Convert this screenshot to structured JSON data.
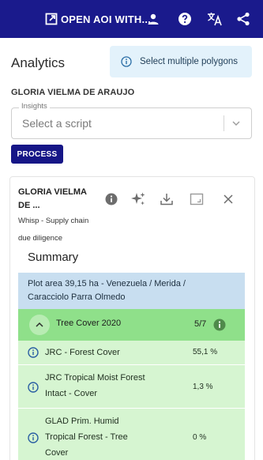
{
  "header": {
    "open_aoi_label": "OPEN AOI WITH...",
    "icons": [
      "open-in-new-icon",
      "user-icon",
      "help-icon",
      "translate-icon",
      "share-icon"
    ],
    "color": "#1a1a8c"
  },
  "panel": {
    "title": "Analytics",
    "hint": "Select multiple polygons",
    "owner": "GLORIA VIELMA DE ARAUJO"
  },
  "insights": {
    "legend": "Insights",
    "placeholder": "Select a script"
  },
  "process_label": "PROCESS",
  "card": {
    "title_line1": "GLORIA VIELMA",
    "title_line2": "DE ...",
    "subtitle_line1": "Whisp - Supply chain",
    "subtitle_line2": "due diligence",
    "icons": [
      "info-icon",
      "sparkle-icon",
      "download-icon",
      "map-view-icon",
      "close-icon"
    ],
    "summary_heading": "Summary",
    "plot_area_line1": "Plot area 39,15 ha - Venezuela / Merida /",
    "plot_area_line2": "Caracciolo Parra Olmedo",
    "tree_cover": {
      "title": "Tree Cover 2020",
      "score": "5/7"
    },
    "rows": [
      {
        "lines": [
          "JRC - Forest Cover"
        ],
        "value": "55,1 %"
      },
      {
        "lines": [
          "JRC Tropical Moist Forest",
          "Intact - Cover"
        ],
        "value": "1,3 %"
      },
      {
        "lines": [
          "GLAD Prim. Humid",
          "Tropical Forest - Tree",
          "Cover"
        ],
        "value": "0 %"
      }
    ]
  },
  "colors": {
    "brand": "#1a1a8c",
    "hint_bg": "#e3f2fb",
    "plot_bg": "#c8def0",
    "tree_header": "#8fe08a",
    "tree_row": "#d6f5d1"
  }
}
